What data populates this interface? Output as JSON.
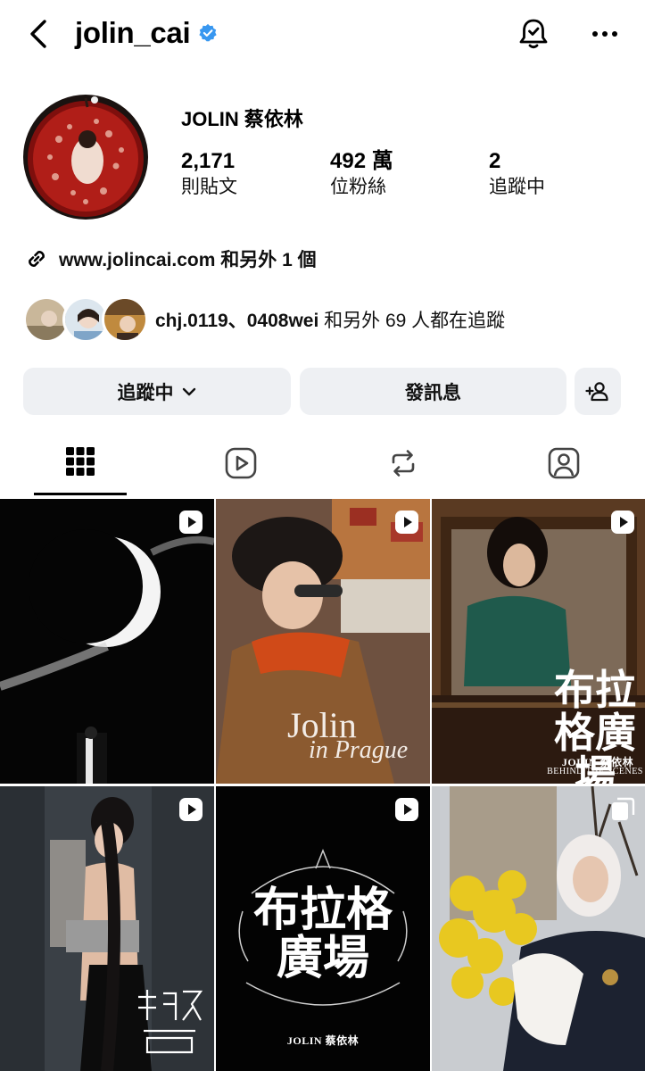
{
  "header": {
    "username": "jolin_cai",
    "verified": true,
    "accent_color": "#3897f0"
  },
  "profile": {
    "display_name": "JOLIN 蔡依林",
    "stats": {
      "posts": {
        "value": "2,171",
        "label": "則貼文"
      },
      "followers": {
        "value": "492 萬",
        "label": "位粉絲"
      },
      "following": {
        "value": "2",
        "label": "追蹤中"
      }
    },
    "link_text": "www.jolincai.com 和另外 1 個",
    "mutual": {
      "names": "chj.0119、0408wei",
      "suffix": " 和另外 69 人都在追蹤"
    }
  },
  "actions": {
    "following_label": "追蹤中",
    "message_label": "發訊息"
  },
  "tabs": [
    {
      "icon": "grid-icon",
      "active": true
    },
    {
      "icon": "reels-icon",
      "active": false
    },
    {
      "icon": "reposts-icon",
      "active": false
    },
    {
      "icon": "tagged-icon",
      "active": false
    }
  ],
  "posts": {
    "p1": {
      "type": "reel"
    },
    "p2": {
      "type": "reel",
      "title": "Jolin",
      "subtitle": "in Prague"
    },
    "p3": {
      "type": "reel",
      "title_cn": "布拉格廣場",
      "brand": "JOLIN 蔡依林",
      "caption": "BEHIND THE SCENES"
    },
    "p4": {
      "type": "reel"
    },
    "p5": {
      "type": "reel",
      "title_cn": "布拉格廣場",
      "brand": "JOLIN 蔡依林"
    },
    "p6": {
      "type": "carousel"
    }
  }
}
